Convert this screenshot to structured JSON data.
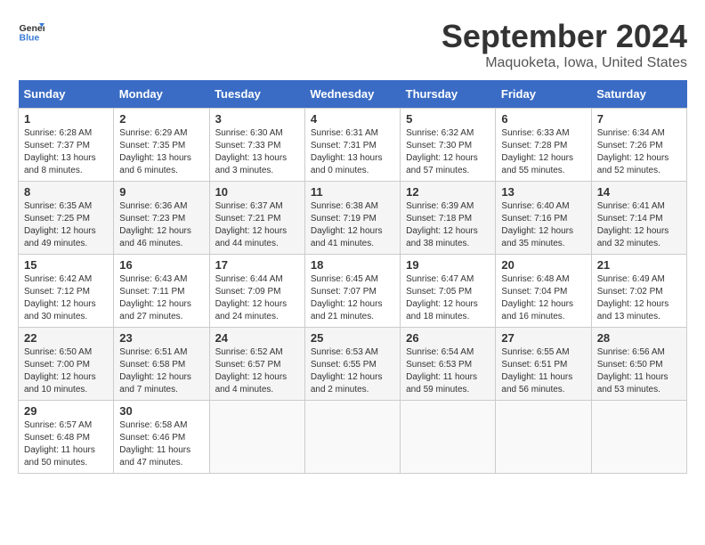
{
  "logo": {
    "line1": "General",
    "line2": "Blue"
  },
  "title": "September 2024",
  "location": "Maquoketa, Iowa, United States",
  "headers": [
    "Sunday",
    "Monday",
    "Tuesday",
    "Wednesday",
    "Thursday",
    "Friday",
    "Saturday"
  ],
  "weeks": [
    [
      {
        "day": "1",
        "sunrise": "Sunrise: 6:28 AM",
        "sunset": "Sunset: 7:37 PM",
        "daylight": "Daylight: 13 hours and 8 minutes."
      },
      {
        "day": "2",
        "sunrise": "Sunrise: 6:29 AM",
        "sunset": "Sunset: 7:35 PM",
        "daylight": "Daylight: 13 hours and 6 minutes."
      },
      {
        "day": "3",
        "sunrise": "Sunrise: 6:30 AM",
        "sunset": "Sunset: 7:33 PM",
        "daylight": "Daylight: 13 hours and 3 minutes."
      },
      {
        "day": "4",
        "sunrise": "Sunrise: 6:31 AM",
        "sunset": "Sunset: 7:31 PM",
        "daylight": "Daylight: 13 hours and 0 minutes."
      },
      {
        "day": "5",
        "sunrise": "Sunrise: 6:32 AM",
        "sunset": "Sunset: 7:30 PM",
        "daylight": "Daylight: 12 hours and 57 minutes."
      },
      {
        "day": "6",
        "sunrise": "Sunrise: 6:33 AM",
        "sunset": "Sunset: 7:28 PM",
        "daylight": "Daylight: 12 hours and 55 minutes."
      },
      {
        "day": "7",
        "sunrise": "Sunrise: 6:34 AM",
        "sunset": "Sunset: 7:26 PM",
        "daylight": "Daylight: 12 hours and 52 minutes."
      }
    ],
    [
      {
        "day": "8",
        "sunrise": "Sunrise: 6:35 AM",
        "sunset": "Sunset: 7:25 PM",
        "daylight": "Daylight: 12 hours and 49 minutes."
      },
      {
        "day": "9",
        "sunrise": "Sunrise: 6:36 AM",
        "sunset": "Sunset: 7:23 PM",
        "daylight": "Daylight: 12 hours and 46 minutes."
      },
      {
        "day": "10",
        "sunrise": "Sunrise: 6:37 AM",
        "sunset": "Sunset: 7:21 PM",
        "daylight": "Daylight: 12 hours and 44 minutes."
      },
      {
        "day": "11",
        "sunrise": "Sunrise: 6:38 AM",
        "sunset": "Sunset: 7:19 PM",
        "daylight": "Daylight: 12 hours and 41 minutes."
      },
      {
        "day": "12",
        "sunrise": "Sunrise: 6:39 AM",
        "sunset": "Sunset: 7:18 PM",
        "daylight": "Daylight: 12 hours and 38 minutes."
      },
      {
        "day": "13",
        "sunrise": "Sunrise: 6:40 AM",
        "sunset": "Sunset: 7:16 PM",
        "daylight": "Daylight: 12 hours and 35 minutes."
      },
      {
        "day": "14",
        "sunrise": "Sunrise: 6:41 AM",
        "sunset": "Sunset: 7:14 PM",
        "daylight": "Daylight: 12 hours and 32 minutes."
      }
    ],
    [
      {
        "day": "15",
        "sunrise": "Sunrise: 6:42 AM",
        "sunset": "Sunset: 7:12 PM",
        "daylight": "Daylight: 12 hours and 30 minutes."
      },
      {
        "day": "16",
        "sunrise": "Sunrise: 6:43 AM",
        "sunset": "Sunset: 7:11 PM",
        "daylight": "Daylight: 12 hours and 27 minutes."
      },
      {
        "day": "17",
        "sunrise": "Sunrise: 6:44 AM",
        "sunset": "Sunset: 7:09 PM",
        "daylight": "Daylight: 12 hours and 24 minutes."
      },
      {
        "day": "18",
        "sunrise": "Sunrise: 6:45 AM",
        "sunset": "Sunset: 7:07 PM",
        "daylight": "Daylight: 12 hours and 21 minutes."
      },
      {
        "day": "19",
        "sunrise": "Sunrise: 6:47 AM",
        "sunset": "Sunset: 7:05 PM",
        "daylight": "Daylight: 12 hours and 18 minutes."
      },
      {
        "day": "20",
        "sunrise": "Sunrise: 6:48 AM",
        "sunset": "Sunset: 7:04 PM",
        "daylight": "Daylight: 12 hours and 16 minutes."
      },
      {
        "day": "21",
        "sunrise": "Sunrise: 6:49 AM",
        "sunset": "Sunset: 7:02 PM",
        "daylight": "Daylight: 12 hours and 13 minutes."
      }
    ],
    [
      {
        "day": "22",
        "sunrise": "Sunrise: 6:50 AM",
        "sunset": "Sunset: 7:00 PM",
        "daylight": "Daylight: 12 hours and 10 minutes."
      },
      {
        "day": "23",
        "sunrise": "Sunrise: 6:51 AM",
        "sunset": "Sunset: 6:58 PM",
        "daylight": "Daylight: 12 hours and 7 minutes."
      },
      {
        "day": "24",
        "sunrise": "Sunrise: 6:52 AM",
        "sunset": "Sunset: 6:57 PM",
        "daylight": "Daylight: 12 hours and 4 minutes."
      },
      {
        "day": "25",
        "sunrise": "Sunrise: 6:53 AM",
        "sunset": "Sunset: 6:55 PM",
        "daylight": "Daylight: 12 hours and 2 minutes."
      },
      {
        "day": "26",
        "sunrise": "Sunrise: 6:54 AM",
        "sunset": "Sunset: 6:53 PM",
        "daylight": "Daylight: 11 hours and 59 minutes."
      },
      {
        "day": "27",
        "sunrise": "Sunrise: 6:55 AM",
        "sunset": "Sunset: 6:51 PM",
        "daylight": "Daylight: 11 hours and 56 minutes."
      },
      {
        "day": "28",
        "sunrise": "Sunrise: 6:56 AM",
        "sunset": "Sunset: 6:50 PM",
        "daylight": "Daylight: 11 hours and 53 minutes."
      }
    ],
    [
      {
        "day": "29",
        "sunrise": "Sunrise: 6:57 AM",
        "sunset": "Sunset: 6:48 PM",
        "daylight": "Daylight: 11 hours and 50 minutes."
      },
      {
        "day": "30",
        "sunrise": "Sunrise: 6:58 AM",
        "sunset": "Sunset: 6:46 PM",
        "daylight": "Daylight: 11 hours and 47 minutes."
      },
      null,
      null,
      null,
      null,
      null
    ]
  ]
}
